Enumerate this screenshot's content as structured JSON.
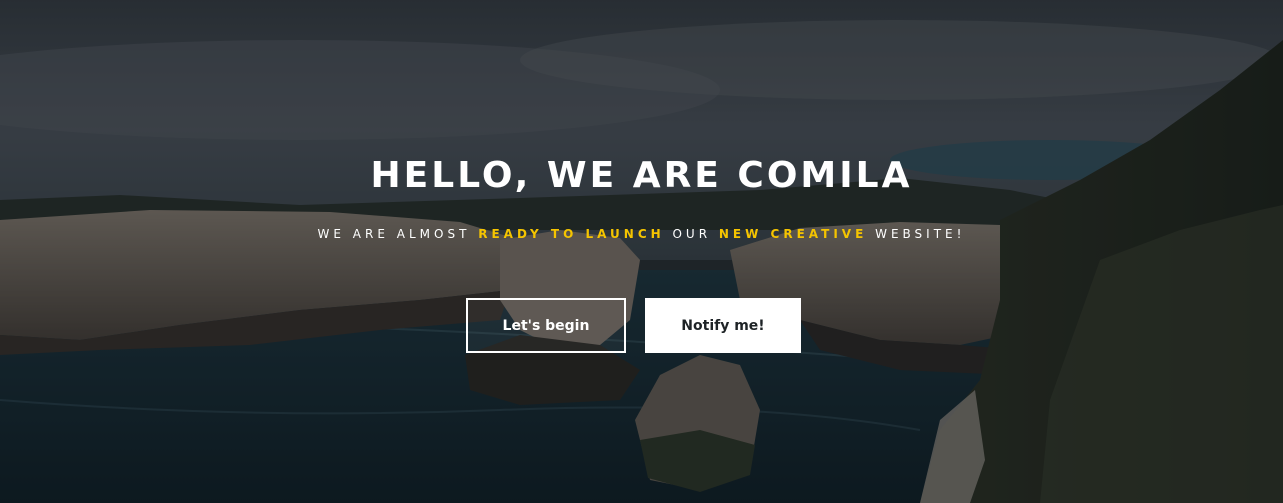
{
  "hero": {
    "title": "HELLO, WE ARE COMILA",
    "tagline": {
      "part1": "WE ARE ALMOST ",
      "highlight1": "READY TO LAUNCH",
      "part2": " OUR ",
      "highlight2": "NEW CREATIVE",
      "part3": " WEBSITE!"
    },
    "accent_color": "#f5c400",
    "buttons": {
      "primary_label": "Let's begin",
      "secondary_label": "Notify me!"
    }
  }
}
